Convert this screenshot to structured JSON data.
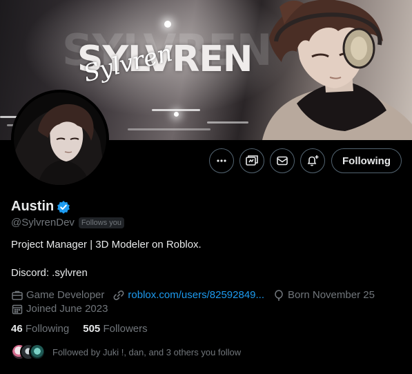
{
  "banner": {
    "logo_text": "SYLVREN",
    "script_text": "Sylvren"
  },
  "actions": {
    "more_icon": "more-icon",
    "subscribe_icon": "subscribe-icon",
    "message_icon": "mail-icon",
    "notify_icon": "bell-plus-icon",
    "following_label": "Following"
  },
  "profile": {
    "name": "Austin",
    "verified": true,
    "handle": "@SylvrenDev",
    "follows_you": "Follows you",
    "bio_line1": "Project Manager | 3D Modeler on Roblox.",
    "bio_line2": "Discord: .sylvren"
  },
  "meta": {
    "category": "Game Developer",
    "link": "roblox.com/users/82592849...",
    "born": "Born November 25",
    "joined": "Joined June 2023"
  },
  "stats": {
    "following_count": "46",
    "following_label": "Following",
    "followers_count": "505",
    "followers_label": "Followers"
  },
  "followed_by": "Followed by Juki !, dan, and 3 others you follow",
  "colors": {
    "accent": "#1d9bf0",
    "muted": "#71767b",
    "text": "#e7e9ea",
    "background": "#000000"
  }
}
